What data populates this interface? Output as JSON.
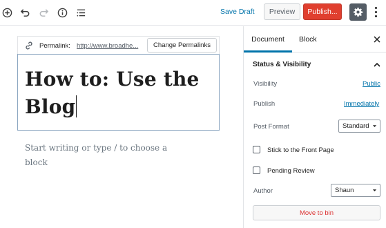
{
  "toolbar": {
    "icons": [
      "add-block-icon",
      "undo-icon",
      "redo-icon",
      "info-icon",
      "block-navigation-icon"
    ],
    "save_draft": "Save Draft",
    "preview": "Preview",
    "publish": "Publish...",
    "settings_icon": "gear-icon",
    "more_icon": "vertical-ellipsis-icon",
    "publish_color": "#e03f2f"
  },
  "editor": {
    "permalink_label": "Permalink:",
    "permalink_url": "http://www.broadhe...",
    "change_permalinks": "Change Permalinks",
    "title_line1": "How to: Use the",
    "title_line2": "Blog",
    "placeholder": "Start writing or type / to choose a block"
  },
  "sidebar": {
    "tabs": [
      {
        "label": "Document",
        "active": true
      },
      {
        "label": "Block",
        "active": false
      }
    ],
    "panel_title": "Status & Visibility",
    "visibility_label": "Visibility",
    "visibility_value": "Public",
    "publish_label": "Publish",
    "publish_value": "Immediately",
    "post_format_label": "Post Format",
    "post_format_value": "Standard",
    "stick_front_label": "Stick to the Front Page",
    "stick_front_checked": false,
    "pending_review_label": "Pending Review",
    "pending_review_checked": false,
    "author_label": "Author",
    "author_value": "Shaun",
    "move_to_bin": "Move to bin",
    "accent_color": "#0073aa",
    "danger_color": "#dc3232"
  }
}
